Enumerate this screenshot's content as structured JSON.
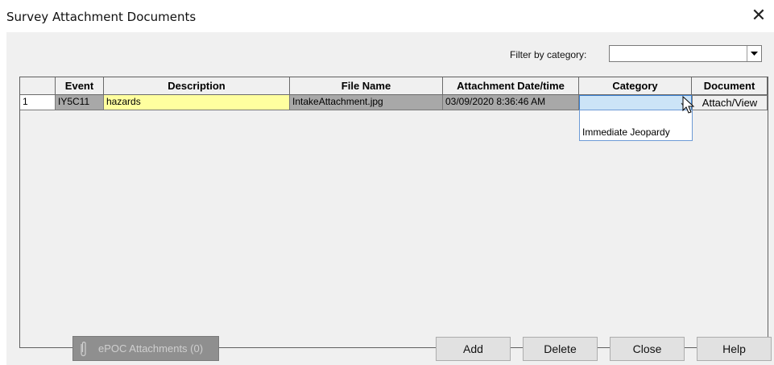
{
  "window": {
    "title": "Survey Attachment Documents",
    "close_glyph": "✕"
  },
  "filter": {
    "label": "Filter by category:",
    "value": ""
  },
  "grid": {
    "headers": [
      "",
      "Event",
      "Description",
      "File Name",
      "Attachment Date/time",
      "Category",
      "Document"
    ],
    "rows": [
      {
        "index": "1",
        "event": "IY5C11",
        "description": "hazards",
        "file_name": "IntakeAttachment.jpg",
        "attachment_datetime": "03/09/2020 8:36:46 AM",
        "category": "",
        "document_button": "Attach/View"
      }
    ]
  },
  "category_dropdown": {
    "options": [
      "",
      "Immediate Jeopardy"
    ]
  },
  "buttons": {
    "epdc": "ePOC Attachments (0)",
    "add": "Add",
    "delete": "Delete",
    "close": "Close",
    "help": "Help"
  },
  "colors": {
    "description_bg": "#ffff9f",
    "readonly_bg": "#a8a8a8",
    "selected_bg": "#cce4f7"
  },
  "icons": {
    "close": "close-icon",
    "dropdown": "dropdown-arrow-icon",
    "paperclip": "paperclip-icon",
    "pointer": "mouse-pointer-icon"
  }
}
